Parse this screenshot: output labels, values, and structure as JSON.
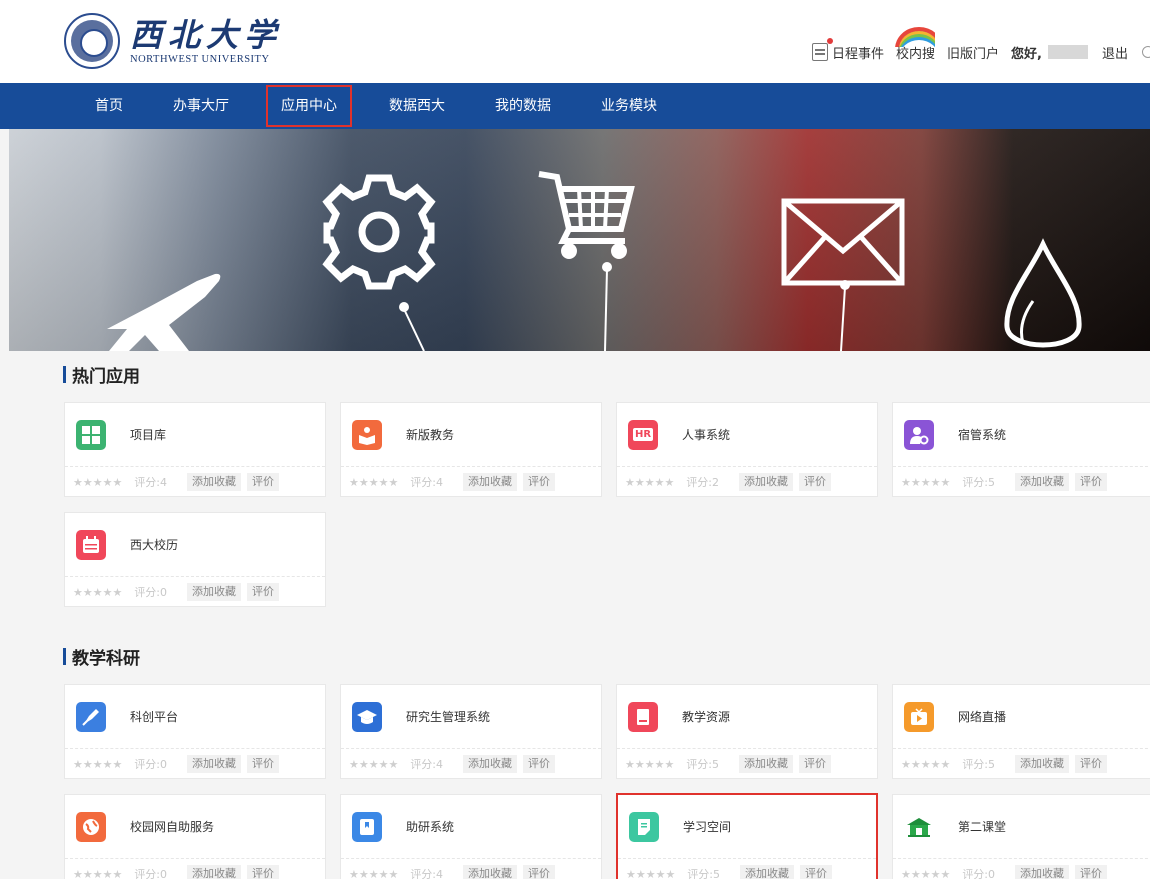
{
  "header": {
    "logo_cn": "西北大学",
    "logo_en": "NORTHWEST UNIVERSITY",
    "links": {
      "schedule": "日程事件",
      "search": "校内搜",
      "old_portal": "旧版门户",
      "greeting": "您好,",
      "logout": "退出"
    }
  },
  "nav": {
    "items": [
      "首页",
      "办事大厅",
      "应用中心",
      "数据西大",
      "我的数据",
      "业务模块"
    ],
    "active_index": 2
  },
  "labels": {
    "fav": "添加收藏",
    "rate": "评价"
  },
  "sections": [
    {
      "title": "热门应用",
      "apps": [
        {
          "name": "项目库",
          "score": "评分:4",
          "color": "#3cb371",
          "icon": "grid-icon"
        },
        {
          "name": "新版教务",
          "score": "评分:4",
          "color": "#f26a3d",
          "icon": "reading-icon"
        },
        {
          "name": "人事系统",
          "score": "评分:2",
          "color": "#f0475a",
          "icon": "hr-document-icon",
          "glyph": "HR"
        },
        {
          "name": "宿管系统",
          "score": "评分:5",
          "color": "#8a54d6",
          "icon": "user-gear-icon"
        },
        {
          "name": "西大校历",
          "score": "评分:0",
          "color": "#f0475a",
          "icon": "calendar-icon"
        }
      ]
    },
    {
      "title": "教学科研",
      "apps": [
        {
          "name": "科创平台",
          "score": "评分:0",
          "color": "#3b7fe0",
          "icon": "rocket-icon"
        },
        {
          "name": "研究生管理系统",
          "score": "评分:4",
          "color": "#2d6fd6",
          "icon": "graduation-cap-icon"
        },
        {
          "name": "教学资源",
          "score": "评分:5",
          "color": "#f0475a",
          "icon": "book-icon"
        },
        {
          "name": "网络直播",
          "score": "评分:5",
          "color": "#f59a2b",
          "icon": "tv-play-icon"
        },
        {
          "name": "校园网自助服务",
          "score": "评分:0",
          "color": "#f26a3d",
          "icon": "globe-icon"
        },
        {
          "name": "助研系统",
          "score": "评分:4",
          "color": "#3b88e6",
          "icon": "bookmark-icon"
        },
        {
          "name": "学习空间",
          "score": "评分:5",
          "color": "#3cc7a0",
          "icon": "study-doc-icon",
          "highlight": true
        },
        {
          "name": "第二课堂",
          "score": "评分:0",
          "color": "#2aa84a",
          "icon": "classroom-icon"
        }
      ]
    }
  ]
}
